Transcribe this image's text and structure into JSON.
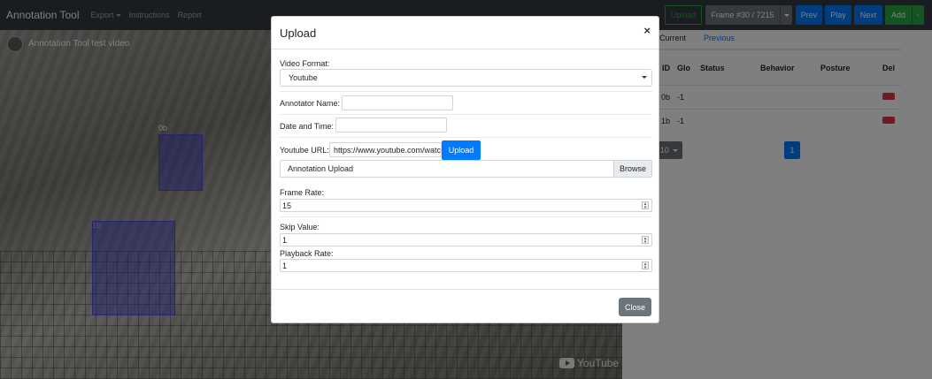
{
  "navbar": {
    "brand": "Annotation Tool",
    "export_label": "Export",
    "instructions_label": "Instructions",
    "report_label": "Report",
    "upload_label": "Upload",
    "frame_label": "Frame #30 / 7215",
    "prev_label": "Prev",
    "play_label": "Play",
    "next_label": "Next",
    "add_label": "Add"
  },
  "video": {
    "title": "Annotation Tool test video",
    "boxes": [
      {
        "label": "0b"
      },
      {
        "label": "1b"
      }
    ],
    "watermark": "YouTube"
  },
  "panel": {
    "tabs": [
      "Current",
      "Previous"
    ],
    "columns": [
      "ID",
      "Glo",
      "Status",
      "Behavior",
      "Posture",
      "Del"
    ],
    "rows": [
      {
        "id": "0b",
        "glo": "-1",
        "status": "",
        "behavior": "",
        "posture": ""
      },
      {
        "id": "1b",
        "glo": "-1",
        "status": "",
        "behavior": "",
        "posture": ""
      }
    ],
    "page_size": "10",
    "page_number": "1"
  },
  "modal": {
    "title": "Upload",
    "close_x": "×",
    "video_format_label": "Video Format:",
    "video_format_value": "Youtube",
    "annotator_label": "Annotator Name:",
    "annotator_value": "",
    "datetime_label": "Date and Time:",
    "datetime_value": "",
    "url_label": "Youtube URL:",
    "url_value": "https://www.youtube.com/watc",
    "url_upload_button": "Upload",
    "file_label": "Annotation Upload",
    "browse_label": "Browse",
    "frame_rate_label": "Frame Rate:",
    "frame_rate_value": "15",
    "skip_label": "Skip Value:",
    "skip_value": "1",
    "playback_label": "Playback Rate:",
    "playback_value": "1",
    "close_button": "Close"
  },
  "colors": {
    "navbar": "#343a40",
    "primary": "#007bff",
    "success": "#28a745",
    "danger": "#dc3545",
    "secondary": "#6c757d"
  }
}
